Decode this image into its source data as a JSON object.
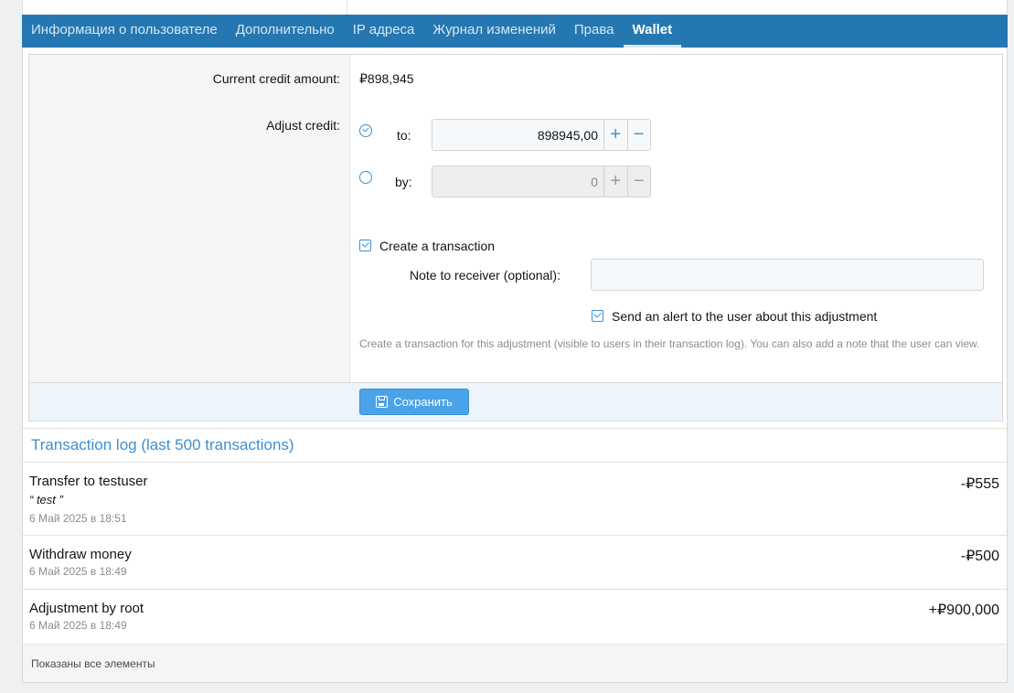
{
  "tabs": [
    {
      "label": "Информация о пользователе"
    },
    {
      "label": "Дополнительно"
    },
    {
      "label": "IP адреса"
    },
    {
      "label": "Журнал изменений"
    },
    {
      "label": "Права"
    },
    {
      "label": "Wallet"
    }
  ],
  "form": {
    "current_credit_label": "Current credit amount:",
    "current_credit_value": "₽898,945",
    "adjust_label": "Adjust credit:",
    "to_label": "to:",
    "to_value": "898945,00",
    "by_label": "by:",
    "by_value": "0",
    "plus_symbol": "+",
    "minus_symbol": "−",
    "create_transaction_label": "Create a transaction",
    "note_label": "Note to receiver (optional):",
    "note_value": "",
    "send_alert_label": "Send an alert to the user about this adjustment",
    "hint": "Create a transaction for this adjustment (visible to users in their transaction log). You can also add a note that the user can view.",
    "save_label": "Сохранить"
  },
  "log": {
    "title": "Transaction log (last 500 transactions)",
    "items": [
      {
        "title": "Transfer to testuser",
        "note": "“ test ”",
        "date": "6 Май 2025 в 18:51",
        "amount": "-₽555"
      },
      {
        "title": "Withdraw money",
        "date": "6 Май 2025 в 18:49",
        "amount": "-₽500"
      },
      {
        "title": "Adjustment by root",
        "date": "6 Май 2025 в 18:49",
        "amount": "+₽900,000"
      }
    ],
    "footer": "Показаны все элементы"
  },
  "colors": {
    "tab_bar": "#2577b1",
    "accent": "#3e8fd0",
    "save_button": "#4aa3e8"
  }
}
